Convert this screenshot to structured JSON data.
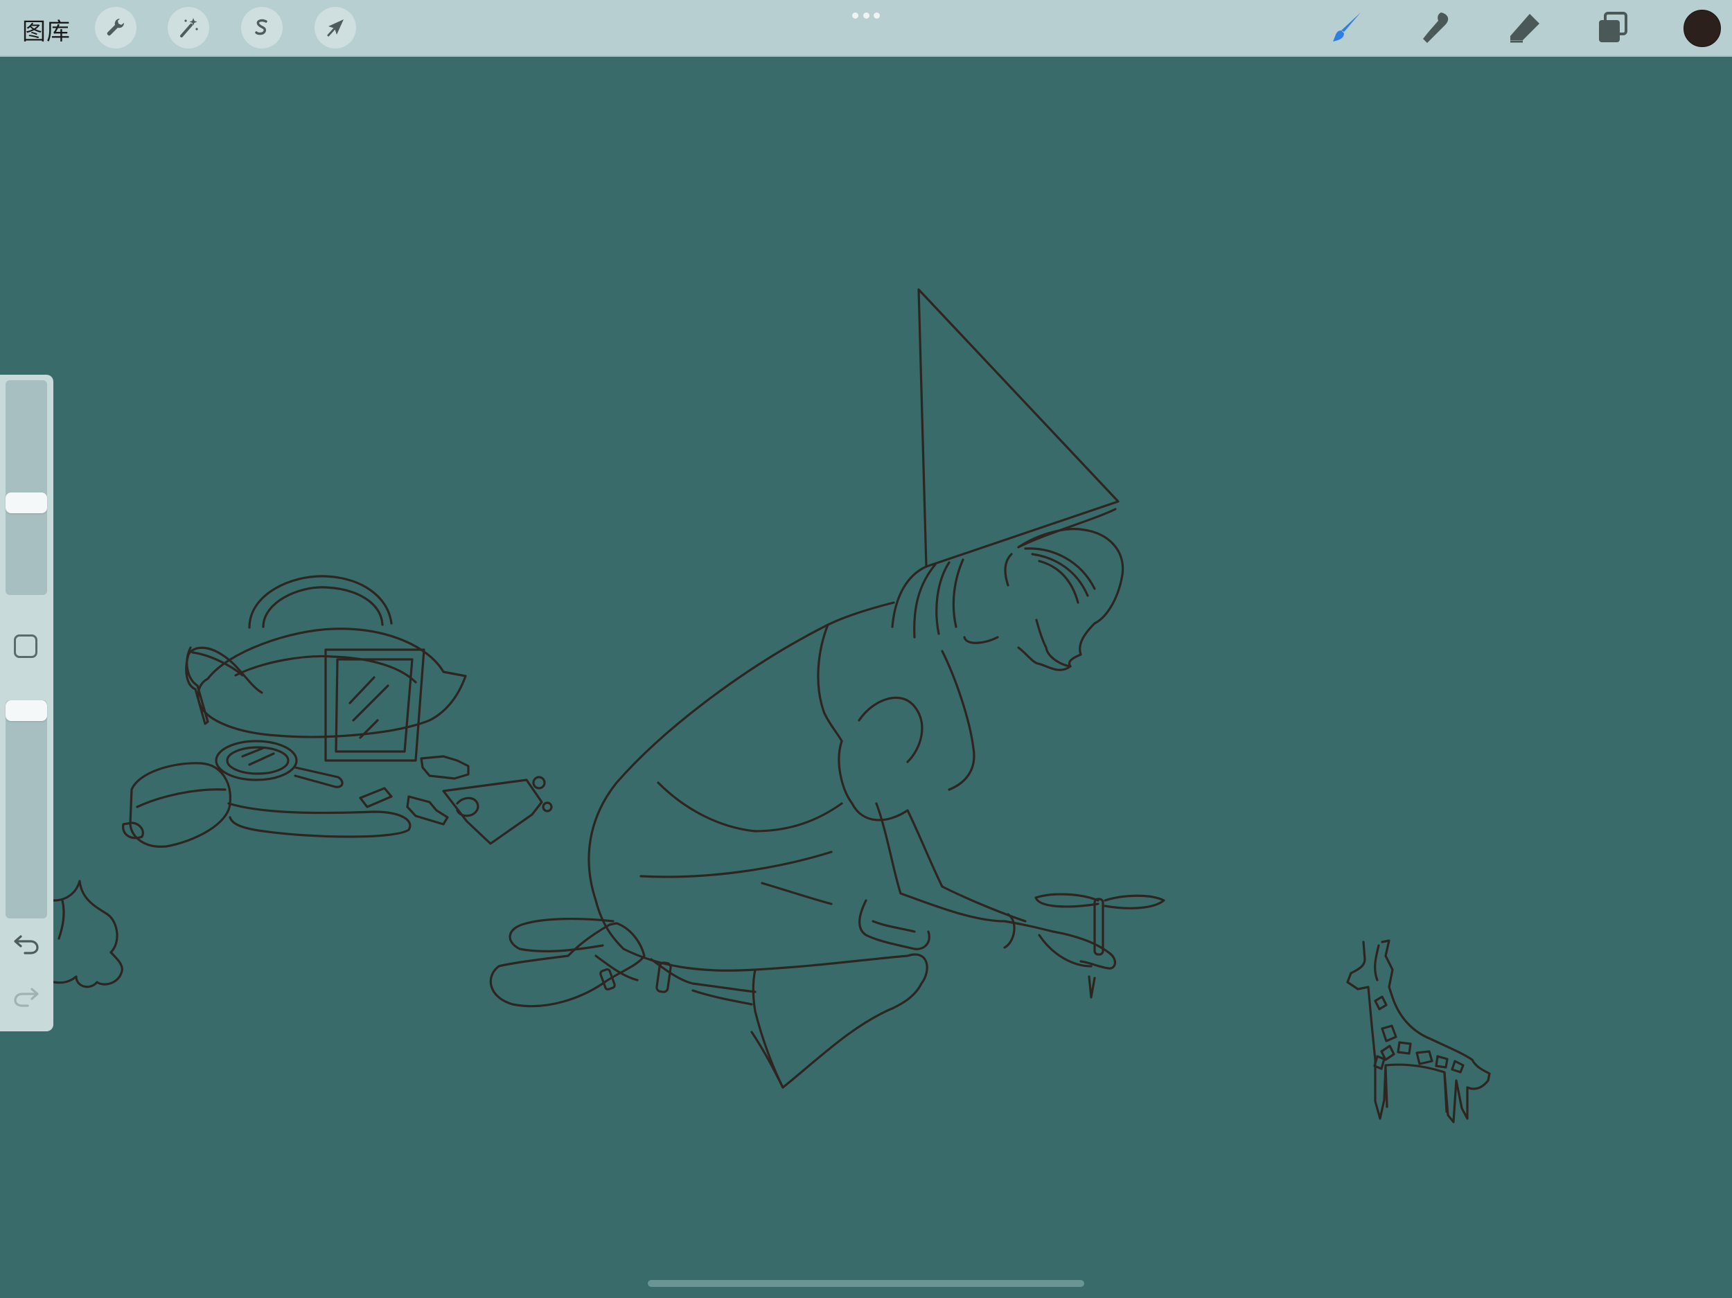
{
  "toolbar": {
    "gallery_label": "图库",
    "left_tools": [
      {
        "icon": "wrench-icon",
        "name": "actions"
      },
      {
        "icon": "magic-wand-icon",
        "name": "adjustments"
      },
      {
        "icon": "selection-icon",
        "name": "selection"
      },
      {
        "icon": "arrow-cursor-icon",
        "name": "transform"
      }
    ],
    "right_tools": [
      {
        "icon": "brush-icon",
        "name": "paint",
        "active": true
      },
      {
        "icon": "smudge-icon",
        "name": "smudge",
        "active": false
      },
      {
        "icon": "eraser-icon",
        "name": "erase",
        "active": false
      },
      {
        "icon": "layers-icon",
        "name": "layers",
        "active": false
      }
    ],
    "current_color": "#2b201b",
    "active_tool_color": "#2f7ee6"
  },
  "sidebar": {
    "brush_size_level": 0.58,
    "opacity_level": 0.05,
    "undo_enabled": true,
    "redo_enabled": false
  },
  "canvas": {
    "background_color": "#396b6a",
    "line_color": "#2e2520"
  }
}
